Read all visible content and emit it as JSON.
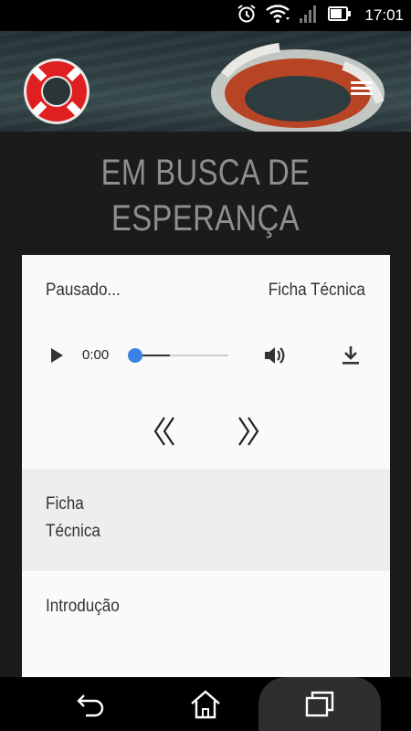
{
  "status_bar": {
    "time": "17:01",
    "icons": [
      "alarm-icon",
      "wifi-icon",
      "signal-icon",
      "battery-icon"
    ]
  },
  "header": {
    "logo": "lifebuoy-logo",
    "menu_icon": "hamburger-menu-icon"
  },
  "site": {
    "title_line1": "EM BUSCA DE",
    "title_line2": "ESPERANÇA"
  },
  "player": {
    "status": "Pausado...",
    "link_label": "Ficha Técnica",
    "time": "0:00",
    "progress": 0.0,
    "accent_color": "#3b82e6",
    "prev_icon": "double-chevron-left-icon",
    "next_icon": "double-chevron-right-icon"
  },
  "menu": {
    "items": [
      {
        "label_line1": "Ficha",
        "label_line2": "Técnica"
      },
      {
        "label": "Introdução"
      }
    ]
  },
  "nav_bar": {
    "icons": [
      "back-icon",
      "home-icon",
      "recents-icon"
    ]
  }
}
